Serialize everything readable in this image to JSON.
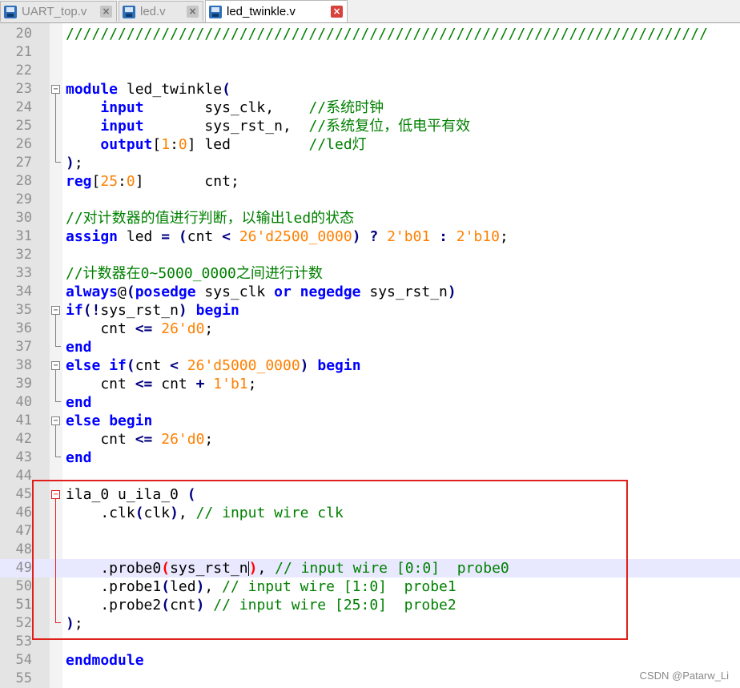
{
  "tabs": [
    {
      "label": "UART_top.v",
      "active": false
    },
    {
      "label": "led.v",
      "active": false
    },
    {
      "label": "led_twinkle.v",
      "active": true
    }
  ],
  "colors": {
    "keyword": "#0000ff",
    "number": "#ff8000",
    "comment": "#008000",
    "highlight_box": "#e0201a",
    "current_line": "#e8e8ff"
  },
  "editor": {
    "current_line": 49,
    "lines": [
      {
        "n": 20,
        "tokens": [
          {
            "t": "//////////////////////////////////////////////////////////////////////////",
            "c": "cm"
          }
        ]
      },
      {
        "n": 21,
        "tokens": []
      },
      {
        "n": 22,
        "tokens": []
      },
      {
        "n": 23,
        "tokens": [
          {
            "t": "module",
            "c": "kw"
          },
          {
            "t": " led_twinkle"
          },
          {
            "t": "(",
            "c": "paren"
          }
        ]
      },
      {
        "n": 24,
        "tokens": [
          {
            "t": "    "
          },
          {
            "t": "input",
            "c": "kw"
          },
          {
            "t": "       sys_clk,    "
          },
          {
            "t": "//系统时钟",
            "c": "cm"
          }
        ]
      },
      {
        "n": 25,
        "tokens": [
          {
            "t": "    "
          },
          {
            "t": "input",
            "c": "kw"
          },
          {
            "t": "       sys_rst_n,  "
          },
          {
            "t": "//系统复位，低电平有效",
            "c": "cm"
          }
        ]
      },
      {
        "n": 26,
        "tokens": [
          {
            "t": "    "
          },
          {
            "t": "output",
            "c": "kw"
          },
          {
            "t": "["
          },
          {
            "t": "1",
            "c": "num"
          },
          {
            "t": ":"
          },
          {
            "t": "0",
            "c": "num"
          },
          {
            "t": "] led         "
          },
          {
            "t": "//led灯",
            "c": "cm"
          }
        ]
      },
      {
        "n": 27,
        "tokens": [
          {
            "t": ")",
            "c": "paren"
          },
          {
            "t": ";"
          }
        ]
      },
      {
        "n": 28,
        "tokens": [
          {
            "t": "reg",
            "c": "kw"
          },
          {
            "t": "["
          },
          {
            "t": "25",
            "c": "num"
          },
          {
            "t": ":"
          },
          {
            "t": "0",
            "c": "num"
          },
          {
            "t": "]       cnt;"
          }
        ]
      },
      {
        "n": 29,
        "tokens": []
      },
      {
        "n": 30,
        "tokens": [
          {
            "t": "//对计数器的值进行判断，以输出led的状态",
            "c": "cm"
          }
        ]
      },
      {
        "n": 31,
        "tokens": [
          {
            "t": "assign",
            "c": "kw"
          },
          {
            "t": " led "
          },
          {
            "t": "=",
            "c": "op"
          },
          {
            "t": " "
          },
          {
            "t": "(",
            "c": "paren"
          },
          {
            "t": "cnt "
          },
          {
            "t": "<",
            "c": "op"
          },
          {
            "t": " "
          },
          {
            "t": "26'd2500_0000",
            "c": "num"
          },
          {
            "t": ")",
            "c": "paren"
          },
          {
            "t": " "
          },
          {
            "t": "?",
            "c": "op"
          },
          {
            "t": " "
          },
          {
            "t": "2'b01",
            "c": "num"
          },
          {
            "t": " "
          },
          {
            "t": ":",
            "c": "op"
          },
          {
            "t": " "
          },
          {
            "t": "2'b10",
            "c": "num"
          },
          {
            "t": ";"
          }
        ]
      },
      {
        "n": 32,
        "tokens": []
      },
      {
        "n": 33,
        "tokens": [
          {
            "t": "//计数器在0~5000_0000之间进行计数",
            "c": "cm"
          }
        ]
      },
      {
        "n": 34,
        "tokens": [
          {
            "t": "always",
            "c": "kw"
          },
          {
            "t": "@"
          },
          {
            "t": "(",
            "c": "paren"
          },
          {
            "t": "posedge",
            "c": "kw"
          },
          {
            "t": " sys_clk "
          },
          {
            "t": "or",
            "c": "kw"
          },
          {
            "t": " "
          },
          {
            "t": "negedge",
            "c": "kw"
          },
          {
            "t": " sys_rst_n"
          },
          {
            "t": ")",
            "c": "paren"
          }
        ]
      },
      {
        "n": 35,
        "tokens": [
          {
            "t": "if",
            "c": "kw"
          },
          {
            "t": "(!",
            "c": "paren"
          },
          {
            "t": "sys_rst_n"
          },
          {
            "t": ")",
            "c": "paren"
          },
          {
            "t": " "
          },
          {
            "t": "begin",
            "c": "kw"
          }
        ]
      },
      {
        "n": 36,
        "tokens": [
          {
            "t": "    cnt "
          },
          {
            "t": "<=",
            "c": "op"
          },
          {
            "t": " "
          },
          {
            "t": "26'd0",
            "c": "num"
          },
          {
            "t": ";"
          }
        ]
      },
      {
        "n": 37,
        "tokens": [
          {
            "t": "end",
            "c": "kw"
          }
        ]
      },
      {
        "n": 38,
        "tokens": [
          {
            "t": "else",
            "c": "kw"
          },
          {
            "t": " "
          },
          {
            "t": "if",
            "c": "kw"
          },
          {
            "t": "(",
            "c": "paren"
          },
          {
            "t": "cnt "
          },
          {
            "t": "<",
            "c": "op"
          },
          {
            "t": " "
          },
          {
            "t": "26'd5000_0000",
            "c": "num"
          },
          {
            "t": ")",
            "c": "paren"
          },
          {
            "t": " "
          },
          {
            "t": "begin",
            "c": "kw"
          }
        ]
      },
      {
        "n": 39,
        "tokens": [
          {
            "t": "    cnt "
          },
          {
            "t": "<=",
            "c": "op"
          },
          {
            "t": " cnt "
          },
          {
            "t": "+",
            "c": "op"
          },
          {
            "t": " "
          },
          {
            "t": "1'b1",
            "c": "num"
          },
          {
            "t": ";"
          }
        ]
      },
      {
        "n": 40,
        "tokens": [
          {
            "t": "end",
            "c": "kw"
          }
        ]
      },
      {
        "n": 41,
        "tokens": [
          {
            "t": "else",
            "c": "kw"
          },
          {
            "t": " "
          },
          {
            "t": "begin",
            "c": "kw"
          }
        ]
      },
      {
        "n": 42,
        "tokens": [
          {
            "t": "    cnt "
          },
          {
            "t": "<=",
            "c": "op"
          },
          {
            "t": " "
          },
          {
            "t": "26'd0",
            "c": "num"
          },
          {
            "t": ";"
          }
        ]
      },
      {
        "n": 43,
        "tokens": [
          {
            "t": "end",
            "c": "kw"
          }
        ]
      },
      {
        "n": 44,
        "tokens": []
      },
      {
        "n": 45,
        "tokens": [
          {
            "t": "ila_0 u_ila_0 "
          },
          {
            "t": "(",
            "c": "paren"
          }
        ]
      },
      {
        "n": 46,
        "tokens": [
          {
            "t": "    .clk"
          },
          {
            "t": "(",
            "c": "paren"
          },
          {
            "t": "clk"
          },
          {
            "t": ")",
            "c": "paren"
          },
          {
            "t": ", "
          },
          {
            "t": "// input wire clk",
            "c": "cm"
          }
        ]
      },
      {
        "n": 47,
        "tokens": []
      },
      {
        "n": 48,
        "tokens": []
      },
      {
        "n": 49,
        "tokens": [
          {
            "t": "    .probe0"
          },
          {
            "t": "(",
            "c": "redparen"
          },
          {
            "t": "sys_rst_n"
          },
          {
            "t": "|",
            "c": "cursor"
          },
          {
            "t": ")",
            "c": "redparen"
          },
          {
            "t": ", "
          },
          {
            "t": "// input wire [0:0]  probe0",
            "c": "cm"
          }
        ]
      },
      {
        "n": 50,
        "tokens": [
          {
            "t": "    .probe1"
          },
          {
            "t": "(",
            "c": "paren"
          },
          {
            "t": "led"
          },
          {
            "t": ")",
            "c": "paren"
          },
          {
            "t": ", "
          },
          {
            "t": "// input wire [1:0]  probe1",
            "c": "cm"
          }
        ]
      },
      {
        "n": 51,
        "tokens": [
          {
            "t": "    .probe2"
          },
          {
            "t": "(",
            "c": "paren"
          },
          {
            "t": "cnt"
          },
          {
            "t": ")",
            "c": "paren"
          },
          {
            "t": " "
          },
          {
            "t": "// input wire [25:0]  probe2",
            "c": "cm"
          }
        ]
      },
      {
        "n": 52,
        "tokens": [
          {
            "t": ")",
            "c": "paren"
          },
          {
            "t": ";"
          }
        ]
      },
      {
        "n": 53,
        "tokens": []
      },
      {
        "n": 54,
        "tokens": [
          {
            "t": "endmodule",
            "c": "kw"
          }
        ]
      },
      {
        "n": 55,
        "tokens": []
      }
    ]
  },
  "folds": [
    {
      "start": 23,
      "end": 27
    },
    {
      "start": 35,
      "end": 37
    },
    {
      "start": 38,
      "end": 40
    },
    {
      "start": 41,
      "end": 43
    },
    {
      "start": 45,
      "end": 52,
      "red": true
    }
  ],
  "watermark": "CSDN @Patarw_Li"
}
